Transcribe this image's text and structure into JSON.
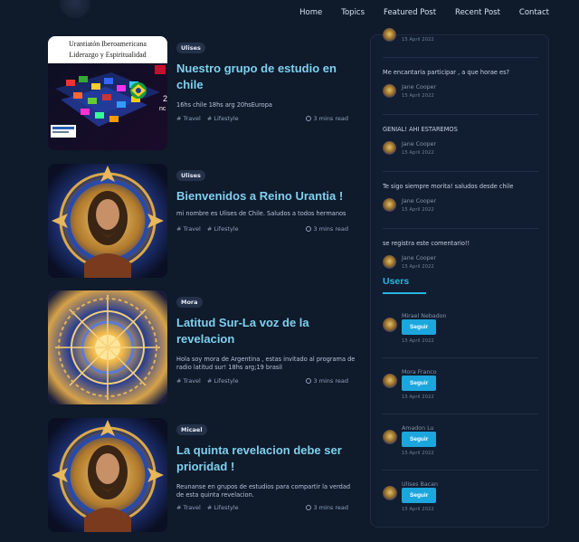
{
  "nav": {
    "items": [
      "Home",
      "Topics",
      "Featured Post",
      "Recent Post",
      "Contact"
    ]
  },
  "posts": [
    {
      "author_tag": "Ulises",
      "title": "Nuestro grupo de estudio en chile",
      "excerpt": "16hs chile 18hs arg 20hsEuropa",
      "categories": [
        "# Travel",
        "# Lifestyle"
      ],
      "read_time": "3 mins read",
      "image_text": {
        "line1": "Urantiatón Iberoamericana",
        "line2": "Liderazgo y Espiritualidad",
        "right1": "2",
        "right2": "nc"
      }
    },
    {
      "author_tag": "Ulises",
      "title": "Bienvenidos a Reino Urantia !",
      "excerpt": "mi nombre es Ulises de Chile. Saludos a todos hermanos",
      "categories": [
        "# Travel",
        "# Lifestyle"
      ],
      "read_time": "3 mins read"
    },
    {
      "author_tag": "Mora",
      "title": "Latitud Sur-La voz de la revelacion",
      "excerpt": "Hola soy mora de Argentina , estas invitado al programa de radio latitud sur! 18hs arg;19 brasil",
      "categories": [
        "# Travel",
        "# Lifestyle"
      ],
      "read_time": "3 mins read"
    },
    {
      "author_tag": "Micael",
      "title": "La quinta revelacion debe ser prioridad !",
      "excerpt": "Reunanse en grupos de estudios para compartir la verdad de esta quinta revelacion.",
      "categories": [
        "# Travel",
        "# Lifestyle"
      ],
      "read_time": "3 mins read"
    }
  ],
  "sidebar": {
    "top_date": "15 April 2022",
    "comments": [
      {
        "text": "Me encantaria participar , a que horae es?",
        "user": "Jane Cooper",
        "date": "15 April 2022"
      },
      {
        "text": "GENIAL! AHI ESTAREMOS",
        "user": "Jane Cooper",
        "date": "15 April 2022"
      },
      {
        "text": "Te sigo siempre morita! saludos desde chile",
        "user": "Jane Cooper",
        "date": "15 April 2022"
      },
      {
        "text": "se registra este comentario!!",
        "user": "Jane Cooper",
        "date": "15 April 2022"
      }
    ],
    "users_heading": "Users",
    "users": [
      {
        "name": "Mirael Nebadon",
        "button": "Seguir",
        "date": "15 April 2022"
      },
      {
        "name": "Mora Franco",
        "button": "Seguir",
        "date": "15 April 2022"
      },
      {
        "name": "Amadon Lu",
        "button": "Seguir",
        "date": "15 April 2022"
      },
      {
        "name": "Ulises Bacan",
        "button": "Seguir",
        "date": "15 April 2022"
      }
    ]
  },
  "colors": {
    "background": "#0f1a2b",
    "title_accent": "#7fd0ee",
    "users_heading": "#2ab4e2",
    "follow_button": "#1ba6dd"
  }
}
